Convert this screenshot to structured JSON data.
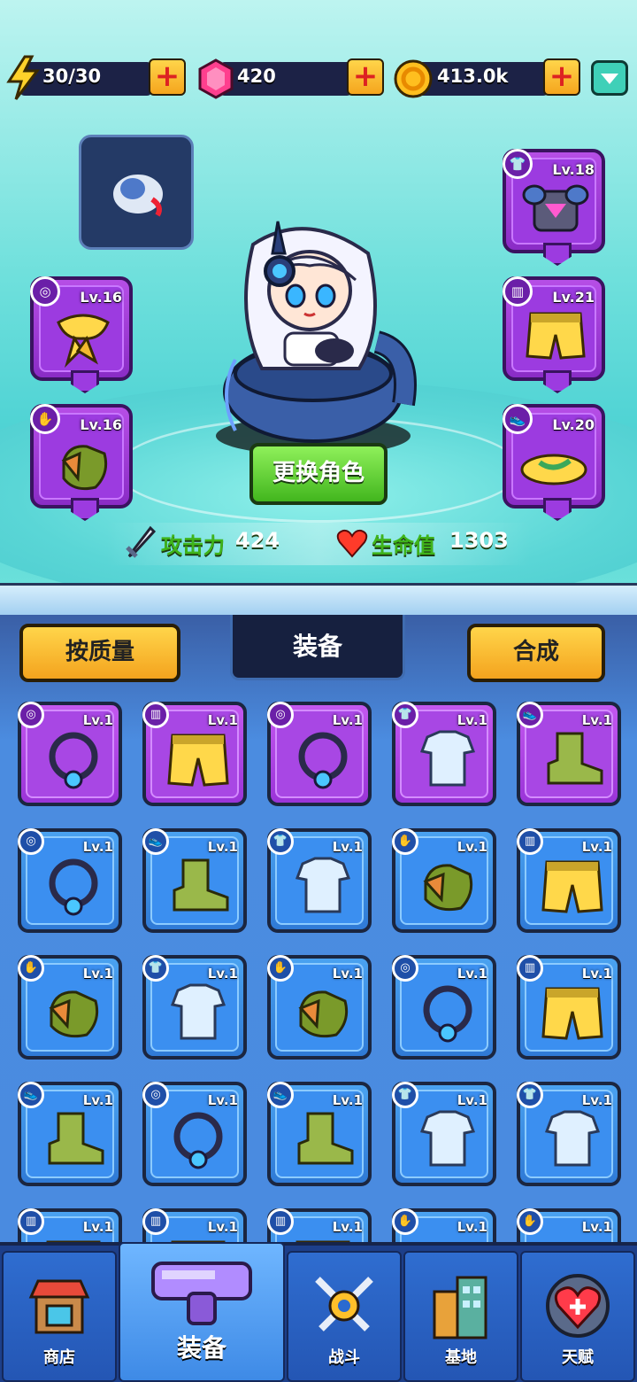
{
  "resources": {
    "energy": "30/30",
    "gems": "420",
    "coins": "413.0k"
  },
  "hero_slots": {
    "necklace_lv": "Lv.16",
    "gloves_lv": "Lv.16",
    "armor_lv": "Lv.18",
    "pants_lv": "Lv.21",
    "shoes_lv": "Lv.20"
  },
  "swap_button": "更换角色",
  "stats": {
    "attack_label": "攻击力",
    "attack_value": "424",
    "hp_label": "生命值",
    "hp_value": "1303"
  },
  "inventory": {
    "sort_label": "按质量",
    "tab_label": "装备",
    "merge_label": "合成",
    "items": [
      {
        "lv": "Lv.1",
        "rarity": "purple",
        "type": "necklace"
      },
      {
        "lv": "Lv.1",
        "rarity": "purple",
        "type": "pants"
      },
      {
        "lv": "Lv.1",
        "rarity": "purple",
        "type": "necklace"
      },
      {
        "lv": "Lv.1",
        "rarity": "purple",
        "type": "armor"
      },
      {
        "lv": "Lv.1",
        "rarity": "purple",
        "type": "shoes"
      },
      {
        "lv": "Lv.1",
        "rarity": "blue",
        "type": "necklace"
      },
      {
        "lv": "Lv.1",
        "rarity": "blue",
        "type": "shoes"
      },
      {
        "lv": "Lv.1",
        "rarity": "blue",
        "type": "armor"
      },
      {
        "lv": "Lv.1",
        "rarity": "blue",
        "type": "gloves"
      },
      {
        "lv": "Lv.1",
        "rarity": "blue",
        "type": "pants"
      },
      {
        "lv": "Lv.1",
        "rarity": "blue",
        "type": "gloves"
      },
      {
        "lv": "Lv.1",
        "rarity": "blue",
        "type": "armor"
      },
      {
        "lv": "Lv.1",
        "rarity": "blue",
        "type": "gloves"
      },
      {
        "lv": "Lv.1",
        "rarity": "blue",
        "type": "necklace"
      },
      {
        "lv": "Lv.1",
        "rarity": "blue",
        "type": "pants"
      },
      {
        "lv": "Lv.1",
        "rarity": "blue",
        "type": "shoes"
      },
      {
        "lv": "Lv.1",
        "rarity": "blue",
        "type": "necklace"
      },
      {
        "lv": "Lv.1",
        "rarity": "blue",
        "type": "shoes"
      },
      {
        "lv": "Lv.1",
        "rarity": "blue",
        "type": "armor"
      },
      {
        "lv": "Lv.1",
        "rarity": "blue",
        "type": "armor"
      },
      {
        "lv": "Lv.1",
        "rarity": "blue",
        "type": "pants"
      },
      {
        "lv": "Lv.1",
        "rarity": "blue",
        "type": "pants"
      },
      {
        "lv": "Lv.1",
        "rarity": "blue",
        "type": "pants"
      },
      {
        "lv": "Lv.1",
        "rarity": "blue",
        "type": "gloves"
      },
      {
        "lv": "Lv.1",
        "rarity": "blue",
        "type": "gloves"
      }
    ]
  },
  "nav": {
    "shop": "商店",
    "equipment": "装备",
    "battle": "战斗",
    "base": "基地",
    "talent": "天赋"
  }
}
